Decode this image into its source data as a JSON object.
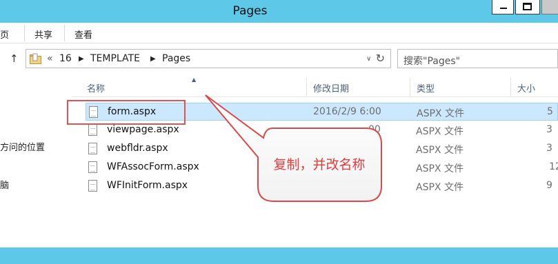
{
  "window": {
    "title": "Pages"
  },
  "ribbon": {
    "tabs": [
      "主页",
      "共享",
      "查看"
    ],
    "tabs_visible": [
      "主页",
      "共享",
      "查看"
    ]
  },
  "address": {
    "overflow": "«",
    "crumbs": [
      "16",
      "TEMPLATE",
      "Pages"
    ],
    "search_placeholder": "搜索\"Pages\""
  },
  "nav": {
    "items": [
      "方问的位置",
      "脑"
    ]
  },
  "columns": {
    "name": "名称",
    "date": "修改日期",
    "type": "类型",
    "size": "大小"
  },
  "files": [
    {
      "name": "form.aspx",
      "date": "2016/2/9 6:00",
      "type": "ASPX 文件",
      "size": "5",
      "selected": true
    },
    {
      "name": "viewpage.aspx",
      "date": "00",
      "type": "ASPX 文件",
      "size": "3",
      "selected": false
    },
    {
      "name": "webfldr.aspx",
      "date": "",
      "type": "ASPX 文件",
      "size": "3",
      "selected": false
    },
    {
      "name": "WFAssocForm.aspx",
      "date": "",
      "type": "ASPX 文件",
      "size": "12",
      "selected": false
    },
    {
      "name": "WFInitForm.aspx",
      "date": "",
      "type": "ASPX 文件",
      "size": "9",
      "selected": false
    }
  ],
  "annotation": {
    "text": "复制，并改名称",
    "color": "#e13c3c"
  },
  "colors": {
    "titlebar": "#5ec8e8",
    "selection": "#cce8ff",
    "highlight_border": "#e05252"
  }
}
